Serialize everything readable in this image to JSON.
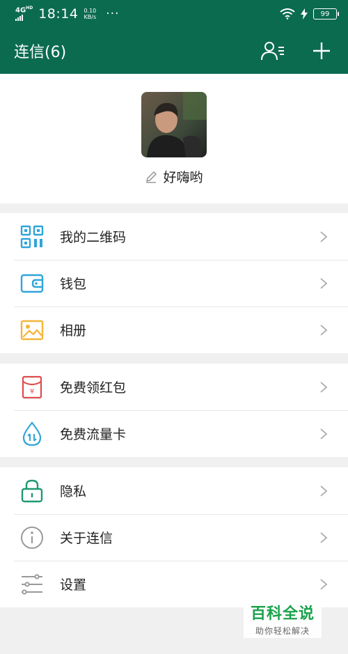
{
  "status_bar": {
    "network": "4G",
    "network_sup": "HD",
    "time": "18:14",
    "speed_value": "0.10",
    "speed_unit": "KB/s",
    "more": "···",
    "battery": "99"
  },
  "header": {
    "title": "连信(6)",
    "contacts_icon": "contacts-icon",
    "add_icon": "plus-icon",
    "background": "#0b6b4f"
  },
  "profile": {
    "name": "好嗨哟",
    "edit_icon": "pencil-icon"
  },
  "menu_groups": [
    {
      "items": [
        {
          "label": "我的二维码",
          "icon": "qr-code-icon",
          "color": "#2fa4d9"
        },
        {
          "label": "钱包",
          "icon": "wallet-icon",
          "color": "#2fa4d9"
        },
        {
          "label": "相册",
          "icon": "photo-album-icon",
          "color": "#f4b53a"
        }
      ]
    },
    {
      "items": [
        {
          "label": "免费领红包",
          "icon": "red-envelope-icon",
          "color": "#e04b4b"
        },
        {
          "label": "免费流量卡",
          "icon": "data-drop-icon",
          "color": "#2fa4d9"
        }
      ]
    },
    {
      "items": [
        {
          "label": "隐私",
          "icon": "lock-icon",
          "color": "#1f9a6e"
        },
        {
          "label": "关于连信",
          "icon": "info-icon",
          "color": "#999999"
        },
        {
          "label": "设置",
          "icon": "settings-sliders-icon",
          "color": "#999999"
        }
      ]
    }
  ],
  "watermark": {
    "title": "百科全说",
    "subtitle": "助你轻松解决"
  }
}
